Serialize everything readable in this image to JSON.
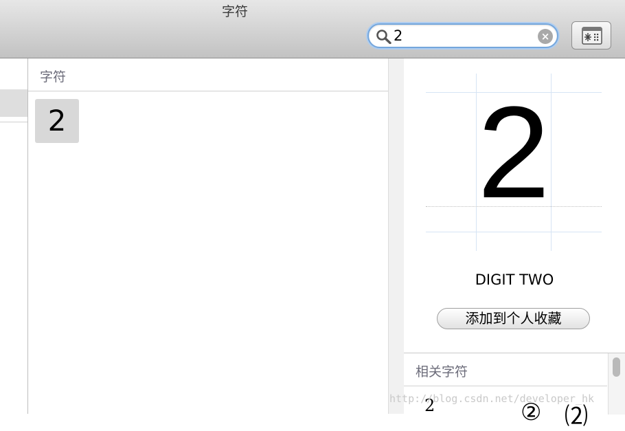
{
  "window": {
    "title": "字符"
  },
  "search": {
    "value": "2"
  },
  "list": {
    "section_label": "字符",
    "characters": [
      "2"
    ]
  },
  "detail": {
    "glyph": "2",
    "name": "DIGIT TWO",
    "add_favorite_label": "添加到个人收藏",
    "related_label": "相关字符",
    "related_chars": [
      "2",
      "②",
      "⑵"
    ]
  },
  "watermark": "http://blog.csdn.net/developer_hk"
}
